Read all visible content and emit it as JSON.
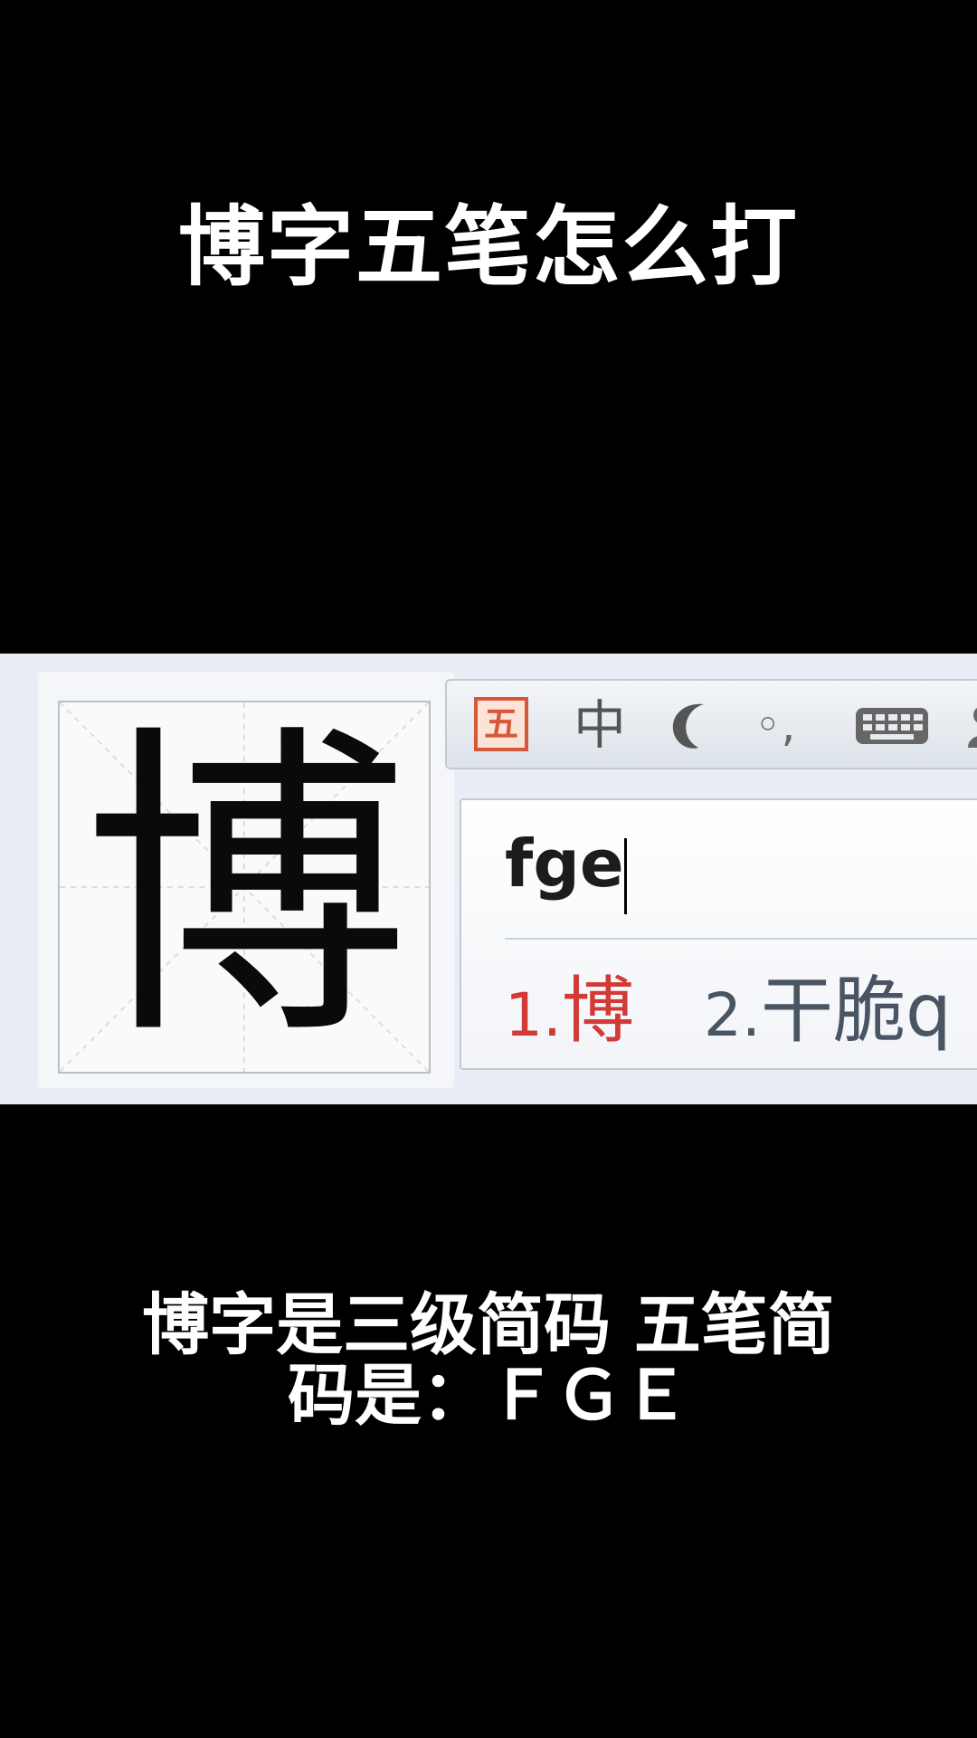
{
  "title": "博字五笔怎么打",
  "character_card": {
    "character": "博"
  },
  "ime_toolbar": {
    "mode_icon": "wubi-mode-icon",
    "mode_icon_text": "五",
    "language_mode": "中",
    "icons": [
      "moon-icon",
      "punctuation-icon",
      "keyboard-icon",
      "person-icon"
    ],
    "punctuation": "◦,"
  },
  "ime_composition": {
    "input": "fge",
    "candidates": [
      {
        "index": "1.",
        "text": "博"
      },
      {
        "index": "2.",
        "text": "干脆q"
      }
    ]
  },
  "caption": {
    "line1": "博字是三级简码 五笔简",
    "line2": "码是：ＦＧＥ"
  },
  "colors": {
    "background": "#000000",
    "selected_candidate": "#d13a35",
    "wubi_icon": "#d5583a"
  }
}
